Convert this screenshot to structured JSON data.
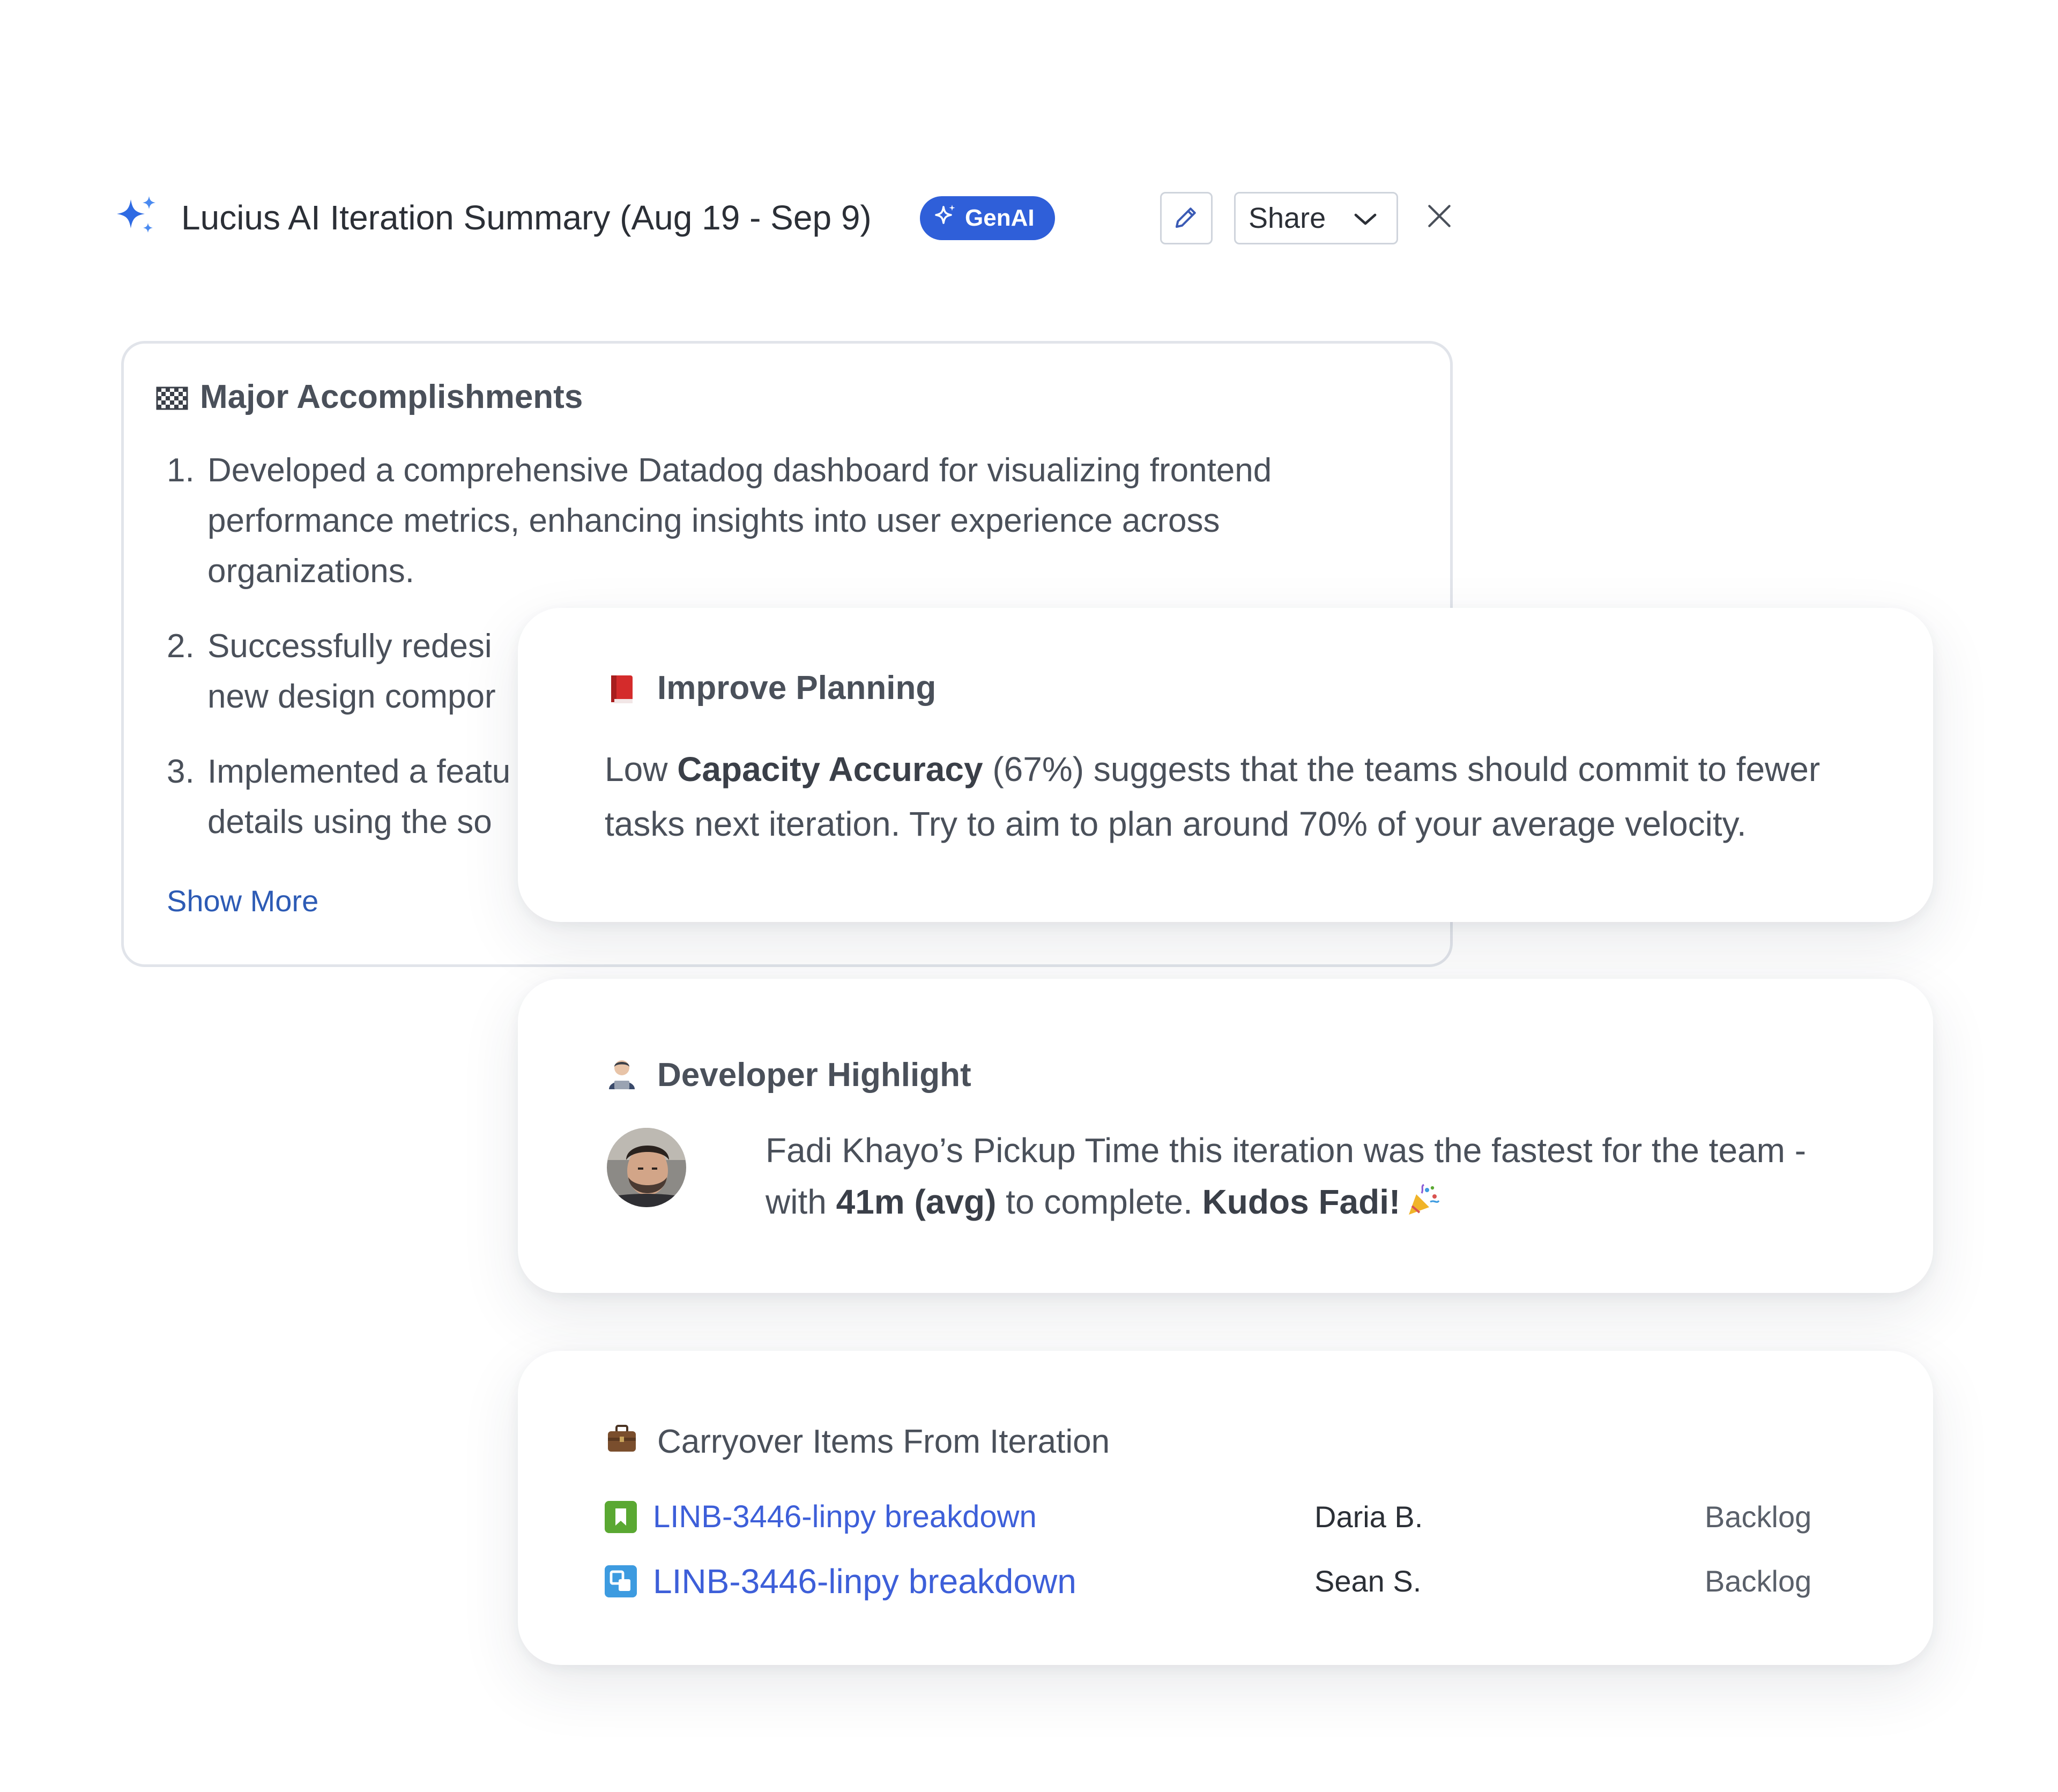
{
  "header": {
    "title": "Lucius AI Iteration Summary (Aug 19 - Sep 9)",
    "badge_label": "GenAI",
    "share_label": "Share",
    "sparkle_icon": "sparkle-icon",
    "edit_icon": "pencil-icon",
    "close_icon": "close-icon"
  },
  "accomplishments": {
    "title": "Major Accomplishments",
    "icon": "checkered-flag-icon",
    "items": [
      {
        "num": "1.",
        "text": "Developed a comprehensive Datadog dashboard for visualizing frontend performance metrics, enhancing insights into user experience across organizations."
      },
      {
        "num": "2.",
        "text": "Successfully redesi"
      },
      {
        "num": "",
        "text": "new design compor"
      },
      {
        "num": "3.",
        "text": "Implemented a featu"
      },
      {
        "num": "",
        "text": "details using the so"
      }
    ],
    "show_more": "Show More"
  },
  "planning": {
    "title": "Improve Planning",
    "icon": "red-book-icon",
    "text_pre": "Low ",
    "text_bold": "Capacity Accuracy",
    "text_post": " (67%) suggests that the teams should commit to fewer tasks next iteration. Try to aim to plan around 70% of your average velocity."
  },
  "developer": {
    "title": "Developer Highlight",
    "icon": "technologist-icon",
    "text_pre": "Fadi Khayo’s Pickup Time this iteration was the fastest for the team - with ",
    "text_bold": "41m (avg)",
    "text_mid": " to complete. ",
    "text_bold2": "Kudos Fadi!",
    "celebration_icon": "party-popper-icon"
  },
  "carryover": {
    "title": "Carryover Items From Iteration",
    "icon": "briefcase-icon",
    "items": [
      {
        "link": "LINB-3446-linpy breakdown",
        "user": "Daria B.",
        "status": "Backlog",
        "icon": "story-bookmark-icon",
        "color": "#5aa832"
      },
      {
        "link": "LINB-3446-linpy breakdown",
        "user": "Sean S.",
        "status": "Backlog",
        "icon": "subtask-icon",
        "color": "#3d9be0"
      }
    ]
  },
  "colors": {
    "accent": "#2f5fd9",
    "link": "#3d5fd9",
    "show_more": "#2d5bb5"
  }
}
